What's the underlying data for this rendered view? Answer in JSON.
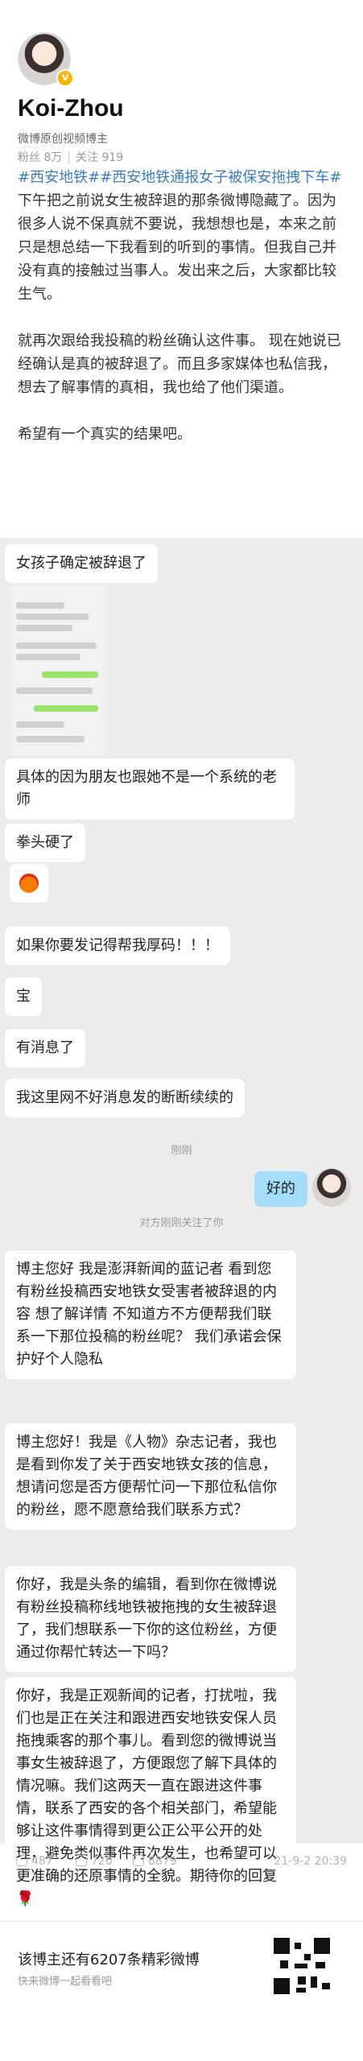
{
  "profile": {
    "name": "Koi-Zhou",
    "description": "微博原创视频博主",
    "fans_label": "粉丝 8万",
    "follow_label": "关注 919"
  },
  "post": {
    "tag1": "#西安地铁#",
    "tag2": "#西安地铁通报女子被保安拖拽下车#",
    "para1_rest": "下午把之前说女生被辞退的那条微博隐藏了。因为很多人说不保真就不要说，我想想也是，本来之前只是想总结一下我看到的听到的事情。但我自己并没有真的接触过当事人。发出来之后，大家都比较生气。",
    "para2": "就再次跟给我投稿的粉丝确认这件事。 现在她说已经确认是真的被辞退了。而且多家媒体也私信我，想去了解事情的真相，我也给了他们渠道。",
    "para3": "希望有一个真实的结果吧。"
  },
  "chat": {
    "msg1": "女孩子确定被辞退了",
    "msg2": "具体的因为朋友也跟她不是一个系统的老师",
    "msg3": "拳头硬了",
    "msg4": "如果你要发记得帮我厚码！！！",
    "msg5": "宝",
    "msg6": "有消息了",
    "msg7": "我这里网不好消息发的断断续续的",
    "sys_time": "刚刚",
    "my_reply": "好的",
    "sys_pat": "对方刚刚关注了你",
    "dm1": "博主您好 我是澎湃新闻的蓝记者 看到您有粉丝投稿西安地铁女受害者被辞退的内容 想了解详情 不知道方不方便帮我们联系一下那位投稿的粉丝呢？ 我们承诺会保护好个人隐私",
    "dm2": "博主您好！我是《人物》杂志记者，我也是看到你发了关于西安地铁女孩的信息，想请问您是否方便帮忙问一下那位私信你的粉丝，愿不愿意给我们联系方式？",
    "dm3": "你好，我是头条的编辑，看到你在微博说有粉丝投稿称线地铁被拖拽的女生被辞退了，我们想联系一下你的这位粉丝，方便通过你帮忙转达一下吗？",
    "dm4": "你好，我是正观新闻的记者，打扰啦，我们也是正在关注和跟进西安地铁安保人员拖拽乘客的那个事儿。看到您的微博说当事女生被辞退了，方便跟您了解下具体的情况嘛。我们这两天一直在跟进这件事情，联系了西安的各个相关部门，希望能够让这件事情得到更公正公平公开的处理，避免类似事件再次发生，也希望可以更准确的还原事情的全貌。期待你的回复🌹"
  },
  "actions": {
    "reposts": "487",
    "comments": "720",
    "likes": "8879",
    "date": "21-9-2 20:39"
  },
  "footer": {
    "more_text": "该博主还有6207条精彩微博",
    "more_sub": "快来微博一起看看吧"
  },
  "colors": {
    "topic_link": "#3b7dc4",
    "my_bubble": "#a3ddf7",
    "chat_bg": "#ececec",
    "badge": "#f7b500"
  }
}
